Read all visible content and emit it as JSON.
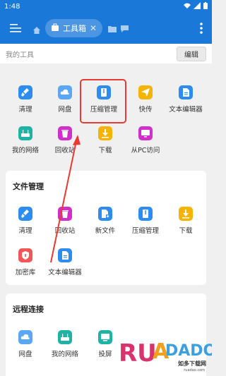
{
  "status": {
    "time": "1:48"
  },
  "appbar": {
    "active_tab": "工具箱"
  },
  "my_tools": {
    "title": "我的工具",
    "edit_label": "编辑",
    "items": [
      {
        "label": "清理",
        "icon": "broom-icon",
        "color": "#2d8cf0"
      },
      {
        "label": "网盘",
        "icon": "cloud-icon",
        "color": "#5aa7f5"
      },
      {
        "label": "压缩管理",
        "icon": "archive-icon",
        "color": "#2d8cf0"
      },
      {
        "label": "快传",
        "icon": "send-icon",
        "color": "#f5b400"
      },
      {
        "label": "文本编辑器",
        "icon": "document-icon",
        "color": "#2d8cf0"
      },
      {
        "label": "我的网络",
        "icon": "router-icon",
        "color": "#1fb3a5"
      },
      {
        "label": "回收站",
        "icon": "trash-icon",
        "color": "#d12fc9"
      },
      {
        "label": "下载",
        "icon": "download-icon",
        "color": "#f5b400"
      },
      {
        "label": "从PC访问",
        "icon": "monitor-icon",
        "color": "#d12fc9"
      }
    ]
  },
  "file_mgmt": {
    "title": "文件管理",
    "items": [
      {
        "label": "清理",
        "icon": "broom-icon"
      },
      {
        "label": "回收站",
        "icon": "trash-icon"
      },
      {
        "label": "新文件",
        "icon": "new-file-icon"
      },
      {
        "label": "压缩管理",
        "icon": "archive-icon"
      },
      {
        "label": "下载",
        "icon": "download-icon"
      },
      {
        "label": "加密库",
        "icon": "shield-icon"
      },
      {
        "label": "文本编辑器",
        "icon": "document-icon"
      }
    ]
  },
  "remote": {
    "title": "远程连接",
    "items": [
      {
        "label": "网盘",
        "icon": "cloud-icon"
      },
      {
        "label": "我的网络",
        "icon": "router-icon"
      },
      {
        "label": "投屏",
        "icon": "cast-icon"
      }
    ]
  },
  "watermark": {
    "brand": "RUADADO",
    "name": "如多下载网",
    "url": "ruadao.com"
  }
}
